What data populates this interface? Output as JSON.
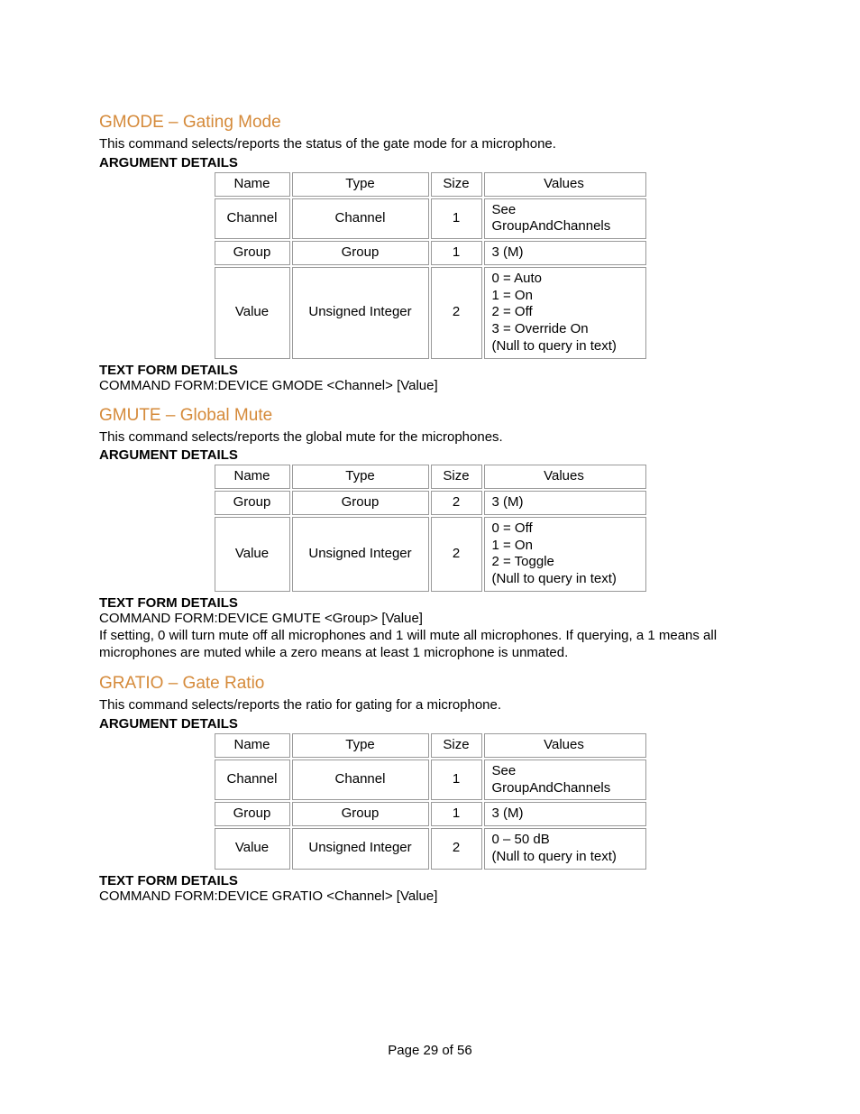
{
  "labels": {
    "argument_details": "ARGUMENT DETAILS",
    "text_form_details": "TEXT FORM DETAILS"
  },
  "table_headers": {
    "name": "Name",
    "type": "Type",
    "size": "Size",
    "values": "Values"
  },
  "sections": [
    {
      "heading": "GMODE – Gating Mode",
      "description": "This command selects/reports the status of the gate mode for a microphone.",
      "rows": [
        {
          "name": "Channel",
          "type": "Channel",
          "size": "1",
          "values": "See GroupAndChannels"
        },
        {
          "name": "Group",
          "type": "Group",
          "size": "1",
          "values": "3 (M)"
        },
        {
          "name": "Value",
          "type": "Unsigned Integer",
          "size": "2",
          "values": "0 = Auto\n1 = On\n2 = Off\n3 = Override On\n(Null to query in text)"
        }
      ],
      "command": "COMMAND FORM:DEVICE GMODE <Channel> [Value]",
      "note": ""
    },
    {
      "heading": "GMUTE – Global Mute",
      "description": "This command selects/reports the global mute for the microphones.",
      "rows": [
        {
          "name": "Group",
          "type": "Group",
          "size": "2",
          "values": "3 (M)"
        },
        {
          "name": "Value",
          "type": "Unsigned Integer",
          "size": "2",
          "values": "0 = Off\n1 = On\n2 = Toggle\n(Null to query in text)"
        }
      ],
      "command": "COMMAND FORM:DEVICE GMUTE <Group> [Value]",
      "note": "If setting, 0 will turn mute off all microphones and 1 will mute all microphones.  If querying, a 1 means all microphones are muted while a zero means at least 1 microphone is unmated."
    },
    {
      "heading": "GRATIO – Gate Ratio",
      "description": "This command selects/reports the ratio for gating for a microphone.",
      "rows": [
        {
          "name": "Channel",
          "type": "Channel",
          "size": "1",
          "values": "See GroupAndChannels"
        },
        {
          "name": "Group",
          "type": "Group",
          "size": "1",
          "values": "3 (M)"
        },
        {
          "name": "Value",
          "type": "Unsigned Integer",
          "size": "2",
          "values": "0 – 50 dB\n(Null to query in text)"
        }
      ],
      "command": "COMMAND FORM:DEVICE GRATIO <Channel> [Value]",
      "note": ""
    }
  ],
  "footer": "Page 29 of 56"
}
